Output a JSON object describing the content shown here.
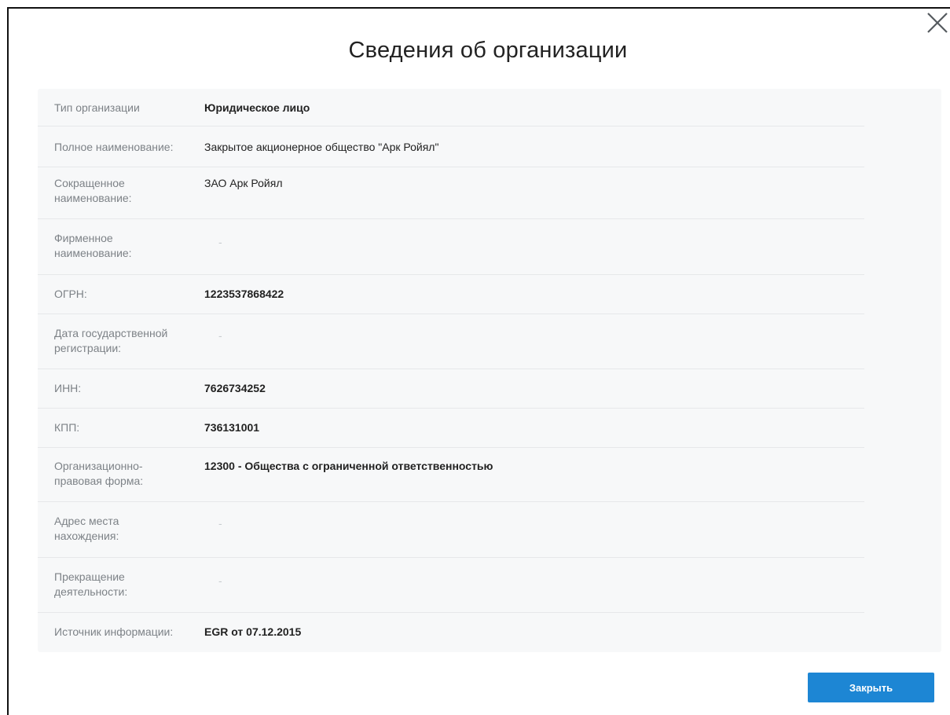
{
  "modal": {
    "title": "Сведения об организации",
    "close_button_label": "Закрыть"
  },
  "fields": [
    {
      "label": "Тип организации",
      "value": "Юридическое лицо",
      "bold": true
    },
    {
      "label": "Полное наименование:",
      "value": "Закрытое акционерное общество \"Арк Ройял\"",
      "bold": false
    },
    {
      "label": "Сокращенное наименование:",
      "value": "ЗАО Арк Ройял",
      "bold": false
    },
    {
      "label": "Фирменное наименование:",
      "value": "-",
      "bold": false
    },
    {
      "label": "ОГРН:",
      "value": "1223537868422",
      "bold": true
    },
    {
      "label": "Дата государственной регистрации:",
      "value": "-",
      "bold": false
    },
    {
      "label": "ИНН:",
      "value": "7626734252",
      "bold": true
    },
    {
      "label": "КПП:",
      "value": "736131001",
      "bold": true
    },
    {
      "label": "Организационно-правовая форма:",
      "value": "12300 - Общества с ограниченной ответственностью",
      "bold": true
    },
    {
      "label": "Адрес места нахождения:",
      "value": "-",
      "bold": false
    },
    {
      "label": "Прекращение деятельности:",
      "value": "-",
      "bold": false
    },
    {
      "label": "Источник информации:",
      "value": "EGR от 07.12.2015",
      "bold": true
    }
  ],
  "colors": {
    "accent": "#1d86d4",
    "label_text": "#7d8287",
    "value_text": "#222222",
    "table_bg": "#f7f8f9"
  },
  "icons": {
    "close": "close-icon"
  }
}
